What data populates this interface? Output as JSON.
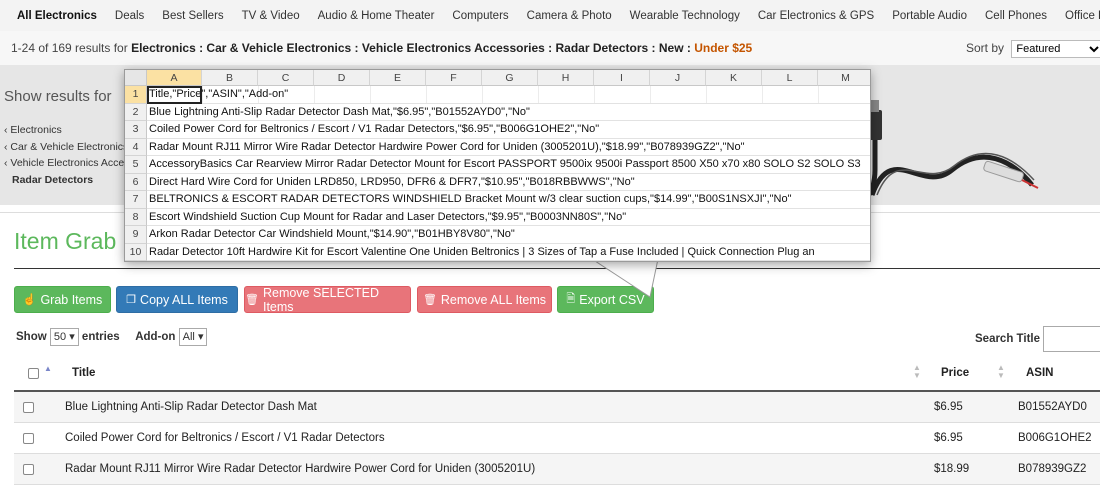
{
  "nav": {
    "items": [
      "All Electronics",
      "Deals",
      "Best Sellers",
      "TV & Video",
      "Audio & Home Theater",
      "Computers",
      "Camera & Photo",
      "Wearable Technology",
      "Car Electronics & GPS",
      "Portable Audio",
      "Cell Phones",
      "Office Electronics"
    ]
  },
  "results": {
    "count": "1-24 of 169 results for",
    "path": "Electronics : Car & Vehicle Electronics : Vehicle Electronics Accessories : Radar Detectors : New :",
    "filter": "Under $25",
    "sort_label": "Sort by",
    "sort_value": "Featured"
  },
  "sidebar": {
    "heading": "Show results for",
    "categories": [
      "Electronics",
      "Car & Vehicle Electronics",
      "Vehicle Electronics Accessories",
      "Radar Detectors"
    ]
  },
  "sheet": {
    "columns": [
      "A",
      "B",
      "C",
      "D",
      "E",
      "F",
      "G",
      "H",
      "I",
      "J",
      "K",
      "L",
      "M"
    ],
    "rows": [
      "Title,\"Price\",\"ASIN\",\"Add-on\"",
      "Blue Lightning Anti-Slip Radar Detector Dash Mat,\"$6.95\",\"B01552AYD0\",\"No\"",
      "Coiled Power Cord for Beltronics / Escort / V1 Radar Detectors,\"$6.95\",\"B006G1OHE2\",\"No\"",
      "Radar Mount RJ11 Mirror Wire Radar Detector Hardwire Power Cord for Uniden (3005201U),\"$18.99\",\"B078939GZ2\",\"No\"",
      "AccessoryBasics Car Rearview Mirror Radar Detector Mount for Escort PASSPORT 9500ix 9500i Passport 8500 X50 x70 x80 SOLO S2 SOLO S3",
      "Direct Hard Wire Cord for Uniden LRD850, LRD950, DFR6 & DFR7,\"$10.95\",\"B018RBBWWS\",\"No\"",
      "BELTRONICS & ESCORT RADAR DETECTORS WINDSHIELD Bracket Mount w/3 clear suction cups,\"$14.99\",\"B00S1NSXJI\",\"No\"",
      "Escort Windshield Suction Cup Mount for Radar and Laser Detectors,\"$9.95\",\"B0003NN80S\",\"No\"",
      "Arkon Radar Detector Car Windshield Mount,\"$14.90\",\"B01HBY8V80\",\"No\"",
      "Radar Detector 10ft Hardwire Kit for Escort Valentine One Uniden Beltronics | 3 Sizes of Tap a Fuse Included | Quick Connection Plug an"
    ]
  },
  "ext": {
    "title": "Item Grab",
    "buttons": {
      "grab": "Grab Items",
      "copy_all": "Copy ALL Items",
      "remove_selected": "Remove SELECTED Items",
      "remove_all": "Remove ALL Items",
      "export": "Export CSV"
    },
    "show_label": "Show",
    "show_value": "50",
    "entries_label": "entries",
    "addon_label": "Add-on",
    "addon_value": "All",
    "search_label": "Search Title"
  },
  "table": {
    "headers": {
      "title": "Title",
      "price": "Price",
      "asin": "ASIN"
    },
    "rows": [
      {
        "title": "Blue Lightning Anti-Slip Radar Detector Dash Mat",
        "price": "$6.95",
        "asin": "B01552AYD0"
      },
      {
        "title": "Coiled Power Cord for Beltronics / Escort / V1 Radar Detectors",
        "price": "$6.95",
        "asin": "B006G1OHE2"
      },
      {
        "title": "Radar Mount RJ11 Mirror Wire Radar Detector Hardwire Power Cord for Uniden (3005201U)",
        "price": "$18.99",
        "asin": "B078939GZ2"
      }
    ]
  },
  "colors": {
    "green": "#5cb85c",
    "blue": "#337ab7",
    "red": "#e8747a",
    "filter_orange": "#c45500"
  }
}
